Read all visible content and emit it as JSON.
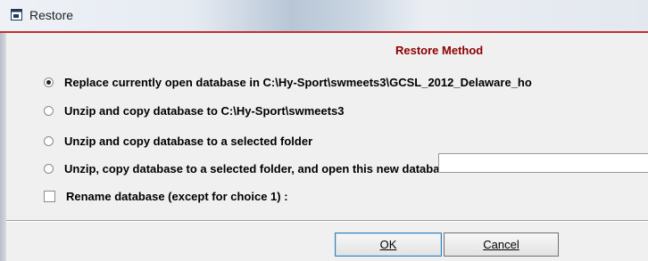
{
  "window": {
    "title": "Restore"
  },
  "heading": "Restore Method",
  "options": [
    {
      "label": "Replace currently open database in C:\\Hy-Sport\\swmeets3\\GCSL_2012_Delaware_ho",
      "selected": true
    },
    {
      "label": "Unzip and copy database to C:\\Hy-Sport\\swmeets3",
      "selected": false
    },
    {
      "label": "Unzip and copy database to a selected folder",
      "selected": false
    },
    {
      "label": "Unzip, copy database to a selected folder, and open this new database",
      "selected": false
    }
  ],
  "rename": {
    "label": "Rename database (except for choice 1) :",
    "checked": false,
    "value": ""
  },
  "buttons": {
    "ok_label": "OK",
    "cancel_label": "Cancel"
  },
  "colors": {
    "heading": "#8b0000",
    "accent_line": "#c43030"
  }
}
